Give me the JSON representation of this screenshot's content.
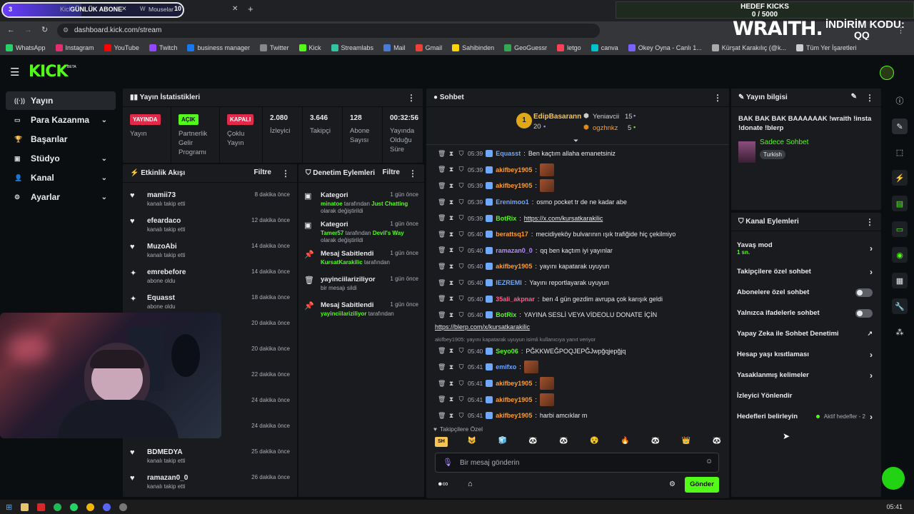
{
  "browser": {
    "tabs": [
      {
        "label": "Kick",
        "overlay_badge": "3",
        "overlay_text": "GÜNLÜK ABONE"
      },
      {
        "label": "Mouselar",
        "overlay_count": "10"
      }
    ],
    "url": "dashboard.kick.com/stream",
    "bookmarks": [
      "WhatsApp",
      "Instagram",
      "YouTube",
      "Twitch",
      "business manager",
      "Twitter",
      "Kick",
      "Streamlabs",
      "Mail",
      "Gmail",
      "Sahibinden",
      "GeoGuessr",
      "letgo",
      "canva",
      "Okey Oyna - Canlı 1...",
      "Kürşat Karakılıç (@k...",
      "Tüm Yer İşaretleri"
    ]
  },
  "overlay": {
    "goal_title": "HEDEF KICKS",
    "goal_value": "0 / 5000",
    "promo_brand": "WRAITH.",
    "promo_label": "İNDİRİM KODU:",
    "promo_code": "QQ"
  },
  "app": {
    "logo": "KICK",
    "logo_beta": "BETA"
  },
  "sidebar": {
    "items": [
      {
        "label": "Yayın",
        "icon": "broadcast-icon"
      },
      {
        "label": "Para Kazanma",
        "icon": "wallet-icon"
      },
      {
        "label": "Başarılar",
        "icon": "trophy-icon"
      },
      {
        "label": "Stüdyo",
        "icon": "camera-icon"
      },
      {
        "label": "Kanal",
        "icon": "person-icon"
      },
      {
        "label": "Ayarlar",
        "icon": "gear-icon"
      }
    ]
  },
  "stats": {
    "title": "Yayın İstatistikleri",
    "cols": [
      {
        "badge": "YAYINDA",
        "label": "Yayın"
      },
      {
        "badge": "AÇIK",
        "label": "Partnerlik Gelir Programı"
      },
      {
        "badge": "KAPALI",
        "label": "Çoklu Yayın"
      },
      {
        "value": "2.080",
        "label": "İzleyici"
      },
      {
        "value": "3.646",
        "label": "Takipçi"
      },
      {
        "value": "128",
        "label": "Abone Sayısı"
      },
      {
        "value": "00:32:56",
        "label": "Yayında Olduğu Süre"
      }
    ],
    "badge_colors": [
      "#e2294a",
      "#53fc18",
      "#e2294a"
    ]
  },
  "activity": {
    "title": "Etkinlik Akışı",
    "filter": "Filtre",
    "items": [
      {
        "name": "mamii73",
        "sub": "kanalı takip etti",
        "time": "8 dakika önce",
        "icon": "heart-icon"
      },
      {
        "name": "efeardaco",
        "sub": "kanalı takip etti",
        "time": "12 dakika önce",
        "icon": "heart-icon"
      },
      {
        "name": "MuzoAbi",
        "sub": "kanalı takip etti",
        "time": "14 dakika önce",
        "icon": "heart-icon"
      },
      {
        "name": "emrebefore",
        "sub": "abone oldu",
        "time": "14 dakika önce",
        "icon": "sparkle-icon"
      },
      {
        "name": "Equasst",
        "sub": "abone oldu",
        "time": "18 dakika önce",
        "icon": "sparkle-icon"
      },
      {
        "name": "",
        "sub": "",
        "time": "20 dakika önce",
        "icon": ""
      },
      {
        "name": "",
        "sub": "",
        "time": "20 dakika önce",
        "icon": ""
      },
      {
        "name": "",
        "sub": "",
        "time": "22 dakika önce",
        "icon": ""
      },
      {
        "name": "",
        "sub": "",
        "time": "24 dakika önce",
        "icon": ""
      },
      {
        "name": "",
        "sub": "",
        "time": "24 dakika önce",
        "icon": ""
      },
      {
        "name": "BDMEDYA",
        "sub": "kanalı takip etti",
        "time": "25 dakika önce",
        "icon": "heart-icon"
      },
      {
        "name": "ramazan0_0",
        "sub": "kanalı takip etti",
        "time": "26 dakika önce",
        "icon": "heart-icon"
      }
    ]
  },
  "moderation": {
    "title": "Denetim Eylemleri",
    "filter": "Filtre",
    "items": [
      {
        "title": "Kategori",
        "time": "1 gün önce",
        "actor": "minatoe",
        "mid": " tarafından ",
        "target": "Just Chatting",
        "tail": "olarak değiştirildi",
        "icon": "category-icon"
      },
      {
        "title": "Kategori",
        "time": "1 gün önce",
        "actor": "Tamer57",
        "mid": " tarafından ",
        "target": "Devil's Way",
        "tail": "olarak değiştirildi",
        "icon": "category-icon"
      },
      {
        "title": "Mesaj Sabitlendi",
        "time": "1 gün önce",
        "actor": "KursatKarakilic",
        "mid": " tarafından",
        "target": "",
        "tail": "",
        "icon": "pin-icon"
      },
      {
        "title": "yayinciilariziliyor",
        "time": "1 gün önce",
        "actor": "",
        "mid": "bir mesajı sildi",
        "target": "",
        "tail": "",
        "icon": "trash-icon"
      },
      {
        "title": "Mesaj Sabitlendi",
        "time": "1 gün önce",
        "actor": "yayinciilariziliyor",
        "mid": " tarafından",
        "target": "",
        "tail": "",
        "icon": "pin-icon"
      }
    ]
  },
  "chat": {
    "title": "Sohbet",
    "leaders": [
      {
        "rank": "1",
        "name": "EdipBasarann",
        "count": "20"
      },
      {
        "name": "Yeniavcii",
        "count": "15"
      },
      {
        "name": "ogzhnkz",
        "count": "5"
      }
    ],
    "messages": [
      {
        "time": "05:39",
        "user": "Equasst",
        "color": "#6fa8ff",
        "text": "Ben kaçtım allaha emanetsiniz"
      },
      {
        "time": "05:39",
        "user": "akifbey1905",
        "color": "#ff9d2e",
        "text": "",
        "emote": true
      },
      {
        "time": "05:39",
        "user": "akifbey1905",
        "color": "#ff9d2e",
        "text": "",
        "emote": true
      },
      {
        "time": "05:39",
        "user": "Erenimoo1",
        "color": "#6fa8ff",
        "text": "osmo pocket tr de ne kadar abe"
      },
      {
        "time": "05:39",
        "user": "BotRix",
        "color": "#53fc18",
        "text": "https://x.com/kursatkarakilic",
        "link": true
      },
      {
        "time": "05:40",
        "user": "berattsq17",
        "color": "#ff9d2e",
        "text": "mecidiyeköy bulvarının ışık trafiğide hiç çekilmiyo"
      },
      {
        "time": "05:40",
        "user": "ramazan0_0",
        "color": "#b58cff",
        "text": "qq ben kaçtım iyi yayınlar"
      },
      {
        "time": "05:40",
        "user": "akifbey1905",
        "color": "#ff9d2e",
        "text": "yayını kapatarak uyuyun"
      },
      {
        "time": "05:40",
        "user": "IEZREMI",
        "color": "#6fa8ff",
        "text": "Yayını reportlayarak uyuyun"
      },
      {
        "time": "05:40",
        "user": "35ali_akpnar",
        "color": "#ff5c8a",
        "text": "ben 4 gün gezdim avrupa çok karışık geldi"
      },
      {
        "time": "05:40",
        "user": "BotRix",
        "color": "#53fc18",
        "text": "YAYINA SESLİ VEYA VİDEOLU DONATE İÇİN"
      }
    ],
    "botrix_link": "https://blerp.com/x/kursatkarakilic",
    "reply_note": "akifbey1905: yayını kapatarak uyuyun isimli kullanıcıya yanıt veriyor",
    "messages2": [
      {
        "time": "05:40",
        "user": "Seyo06",
        "color": "#53fc18",
        "text": "PĞKKWEĞPOQJEPĞJwpğqjepğjq"
      },
      {
        "time": "05:41",
        "user": "emifxo",
        "color": "#6fa8ff",
        "text": "",
        "emote": true
      },
      {
        "time": "05:41",
        "user": "akifbey1905",
        "color": "#ff9d2e",
        "text": "",
        "emote": true
      },
      {
        "time": "05:41",
        "user": "akifbey1905",
        "color": "#ff9d2e",
        "text": "",
        "emote": true
      },
      {
        "time": "05:41",
        "user": "akifbey1905",
        "color": "#ff9d2e",
        "text": "harbi amcıklar m"
      }
    ],
    "followers_only": "Takipçilere Özel",
    "emotes": [
      "SH",
      "😺",
      "🧊",
      "🐼",
      "🐼",
      "😵",
      "🔥",
      "🐼",
      "👑",
      "🐼"
    ],
    "input_placeholder": "Bir mesaj gönderin",
    "send_label": "Gönder"
  },
  "stream_info": {
    "title": "Yayın bilgisi",
    "text": "BAK BAK BAK BAAAAAAK !wraith !insta !donate !blerp",
    "category": "Sadece Sohbet",
    "tag": "Turkish"
  },
  "channel_actions": {
    "title": "Kanal Eylemleri",
    "items": [
      {
        "label": "Yavaş mod",
        "sub": "1 sn.",
        "control": "chevron"
      },
      {
        "label": "Takipçilere özel sohbet",
        "control": "chevron"
      },
      {
        "label": "Abonelere özel sohbet",
        "control": "toggle"
      },
      {
        "label": "Yalnızca ifadelerle sohbet",
        "control": "toggle"
      },
      {
        "label": "Yapay Zeka ile Sohbet Denetimi",
        "control": "external"
      },
      {
        "label": "Hesap yaşı kısıtlaması",
        "control": "chevron"
      },
      {
        "label": "Yasaklanmış kelimeler",
        "control": "chevron"
      },
      {
        "label": "İzleyici Yönlendir",
        "control": "none"
      },
      {
        "label": "Hedefleri belirleyin",
        "control": "chevron",
        "extra": "Aktif hedefler - 2"
      }
    ]
  },
  "taskbar": {
    "clock": "05:41"
  },
  "colors": {
    "accent": "#53fc18",
    "panel": "#191b1f",
    "bg": "#0b0e10"
  }
}
